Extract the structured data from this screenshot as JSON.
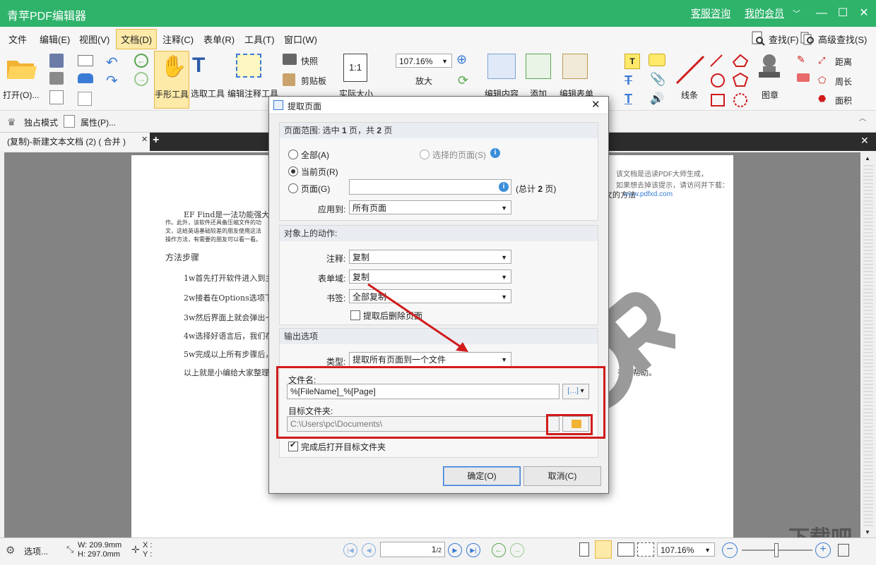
{
  "app": {
    "title": "青苹PDF编辑器",
    "link_support": "客服咨询",
    "link_member": "我的会员",
    "accent": "#2fb36b"
  },
  "menu": [
    "文件",
    "编辑(E)",
    "视图(V)",
    "文档(D)",
    "注释(C)",
    "表单(R)",
    "工具(T)",
    "窗口(W)"
  ],
  "menu_right": {
    "find": "查找(F)",
    "advanced_find": "高级查找(S)"
  },
  "ribbon": {
    "open": "打开(O)...",
    "hand": "手形工具",
    "select": "选取工具",
    "edit_annot": "编辑注释工具",
    "snapshot": "快照",
    "clipboard": "剪贴板",
    "actual_size": "实际大小",
    "zoom_value": "107.16%",
    "zoom_in": "放大",
    "edit_content": "编辑内容",
    "add": "添加",
    "edit_form": "编辑表单",
    "line": "线条",
    "stamp": "图章",
    "distance": "距离",
    "perimeter": "周长",
    "area": "面积"
  },
  "subbar": {
    "exclusive": "独占模式",
    "properties": "属性(P)..."
  },
  "doc_tab": "(复制)-新建文本文档 (2) ( 合并 )",
  "document": {
    "header_note": [
      "该文档是迅读PDF大师生成，",
      "如果想去掉该提示，请访问并下载：",
      "www.pdfxd.com"
    ],
    "right_fragment": "文的方法",
    "para_main": "EF Find是一法功能强大的",
    "para_lines": [
      "作。此外，该软件还具备压缩文件的功",
      "文，这给英语基础较差的朋友使用这法",
      "操作方法，有需要的朋友可以看一看。"
    ],
    "heading": "方法步骤",
    "steps": [
      "1w首先打开软件进入到主",
      "2w接着在Options选项下",
      "3w然后界面上就会弹出一",
      "4w选择好语言后，我们在",
      "5w完成以上所有步骤后，"
    ],
    "summary": "以上就是小编给大家整理",
    "summary_right": "有所帮助。",
    "watermark": "下载吧"
  },
  "dialog": {
    "title": "提取页面",
    "range_header_prefix": "页面范围: 选中 ",
    "range_selected": "1",
    "range_header_mid": " 页，共 ",
    "range_total": "2",
    "range_header_suffix": " 页",
    "opt_all": "全部(A)",
    "opt_selected_pages": "选择的页面(S)",
    "opt_current": "当前页(R)",
    "opt_pages": "页面(G)",
    "pages_input_value": "",
    "total_prefix": "(总计 ",
    "total_value": "2",
    "total_suffix": " 页)",
    "apply_label": "应用到:",
    "apply_value": "所有页面",
    "actions_header": "对象上的动作:",
    "annot_label": "注释:",
    "annot_value": "复制",
    "form_label": "表单域:",
    "form_value": "复制",
    "bookmark_label": "书签:",
    "bookmark_value": "全部复制",
    "delete_after": "提取后删除页面",
    "output_header": "输出选项",
    "type_label": "类型:",
    "type_value": "提取所有页面到一个文件",
    "filename_label": "文件名:",
    "filename_value": "%[FileName]_%[Page]",
    "folder_label": "目标文件夹:",
    "folder_value": "C:\\Users\\pc\\Documents\\",
    "open_after": "完成后打开目标文件夹",
    "ok": "确定(O)",
    "cancel": "取消(C)"
  },
  "status": {
    "options": "选项...",
    "width": "W: 209.9mm",
    "height": "H: 297.0mm",
    "x": "X :",
    "y": "Y :",
    "page_value": "1",
    "page_total": "/2",
    "zoom_value": "107.16%"
  }
}
